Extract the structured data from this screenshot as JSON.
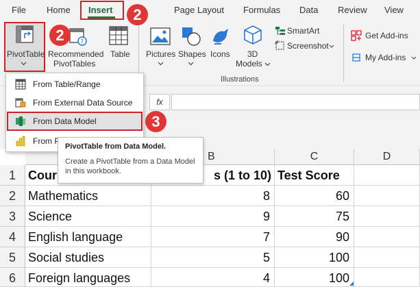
{
  "ribbon_tabs": [
    "File",
    "Home",
    "Insert",
    "Page Layout",
    "Formulas",
    "Data",
    "Review",
    "View"
  ],
  "ribbon": {
    "pivot_table": "PivotTable",
    "recommended": "Recommended",
    "pivot_tables": "PivotTables",
    "table": "Table",
    "pictures": "Pictures",
    "shapes": "Shapes",
    "icons": "Icons",
    "models_3d": "3D",
    "models": "Models",
    "smartart": "SmartArt",
    "screenshot": "Screenshot",
    "illustrations_group": "Illustrations",
    "get_addins": "Get Add-ins",
    "my_addins": "My Add-ins"
  },
  "formula_bar": {
    "fx": "fx"
  },
  "badges": {
    "insert": "2",
    "pivot": "2",
    "data_model": "3"
  },
  "menu": {
    "items": [
      "From Table/Range",
      "From External Data Source",
      "From Data Model",
      "From P"
    ],
    "selected": "From Data Model"
  },
  "tooltip": {
    "title": "PivotTable from Data Model.",
    "body": "Create a PivotTable from a Data Model in this workbook."
  },
  "sheet": {
    "columns": [
      "B",
      "C",
      "D"
    ],
    "rows": [
      "1",
      "2",
      "3",
      "4",
      "5",
      "6"
    ],
    "header_a": "Cour",
    "header_b": "s (1 to 10)",
    "header_c": "Test Score",
    "data": [
      {
        "course": "Mathematics",
        "b": "8",
        "c": "60"
      },
      {
        "course": "Science",
        "b": "9",
        "c": "75"
      },
      {
        "course": "English language",
        "b": "7",
        "c": "90"
      },
      {
        "course": "Social studies",
        "b": "5",
        "c": "100"
      },
      {
        "course": "Foreign languages",
        "b": "4",
        "c": "100"
      }
    ]
  },
  "colors": {
    "accent_green": "#1e7b45",
    "highlight_red": "#d0202a",
    "badge_red": "#e23636"
  }
}
